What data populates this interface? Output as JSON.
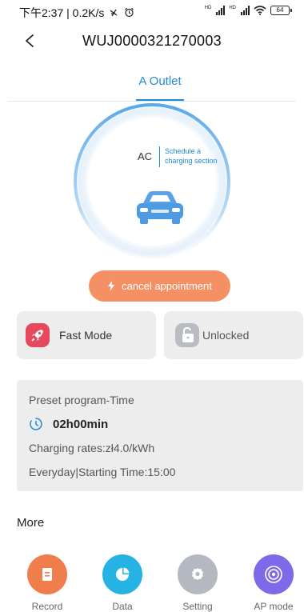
{
  "status_bar": {
    "time_speed": "下午2:37 | 0.2K/s",
    "battery": "64",
    "signal_label": "HD"
  },
  "header": {
    "title": "WUJ0000321270003"
  },
  "tabs": [
    {
      "label": "A Outlet",
      "active": true
    }
  ],
  "dial": {
    "type_label": "AC",
    "schedule_label_line1": "Schedule a",
    "schedule_label_line2": "charging section"
  },
  "actions": {
    "cancel_label": "cancel appointment"
  },
  "modes": {
    "fast_label": "Fast Mode",
    "lock_label": "Unlocked"
  },
  "preset": {
    "title": "Preset program-Time",
    "duration": "02h00min",
    "rates": "Charging rates:zł4.0/kWh",
    "schedule": "Everyday|Starting Time:15:00"
  },
  "more": {
    "title": "More",
    "items": [
      {
        "label": "Record",
        "icon": "record-icon"
      },
      {
        "label": "Data",
        "icon": "pie-chart-icon"
      },
      {
        "label": "Setting",
        "icon": "gear-icon"
      },
      {
        "label": "AP mode",
        "icon": "wireless-icon"
      }
    ]
  },
  "colors": {
    "accent": "#1e8bd8",
    "cancel": "#f59064",
    "fast": "#e6485c",
    "record": "#f07e4c",
    "data": "#25b3e4",
    "setting": "#b4b8c0",
    "ap": "#7e6ae8"
  }
}
